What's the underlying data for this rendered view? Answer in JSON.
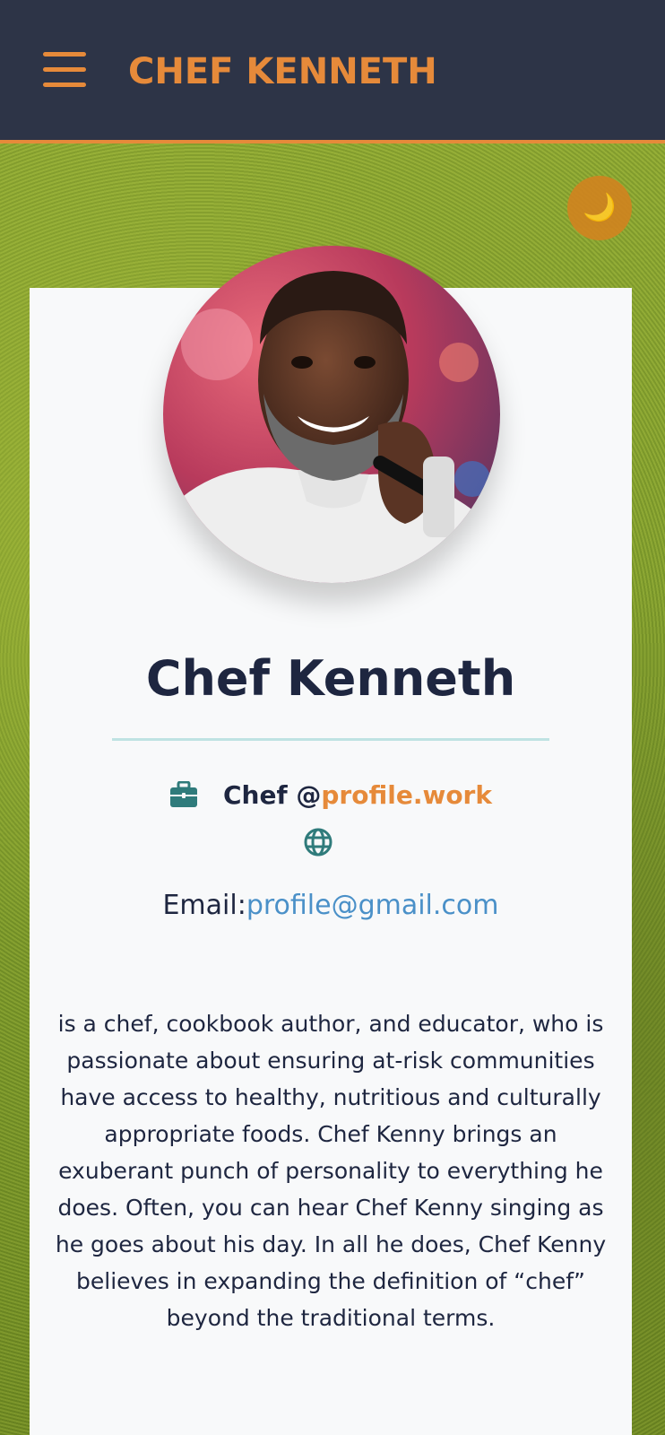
{
  "header": {
    "brand": "CHEF KENNETH",
    "menu_icon": "hamburger-menu-icon",
    "colors": {
      "bar": "#2d3447",
      "accent": "#e68a3a"
    }
  },
  "theme_toggle": {
    "icon": "moon-icon",
    "glyph": "🌙"
  },
  "profile": {
    "avatar_icon": "profile-photo",
    "name": "Chef Kenneth",
    "work": {
      "role": "Chef",
      "at": "@",
      "handle": "profile.work",
      "icon": "briefcase-icon"
    },
    "website_icon": "globe-icon",
    "email_label": "Email:",
    "email": "profile@gmail.com",
    "bio": "is a chef, cookbook author, and educator, who is passionate about ensuring at-risk communities have access to healthy, nutritious and culturally appropriate foods. Chef Kenny brings an exuberant punch of personality to everything he does. Often, you can hear Chef Kenny singing as he goes about his day. In all he does, Chef Kenny believes in expanding the definition of “chef” beyond the traditional terms."
  }
}
